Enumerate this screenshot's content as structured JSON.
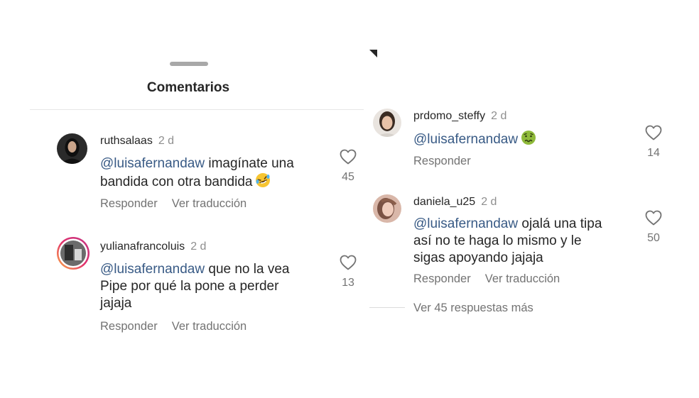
{
  "sheet": {
    "title": "Comentarios"
  },
  "left_comments": [
    {
      "username": "ruthsalaas",
      "time": "2 d",
      "mention": "@luisafernandaw",
      "lines": [
        "imagínate una",
        "bandida con otra bandida"
      ],
      "likes": "45",
      "reply": "Responder",
      "translate": "Ver traducción"
    },
    {
      "username": "yulianafrancoluis",
      "time": "2 d",
      "mention": "@luisafernandaw",
      "lines": [
        "que no la vea",
        "Pipe por qué la pone a perder",
        "jajaja"
      ],
      "likes": "13",
      "reply": "Responder",
      "translate": "Ver traducción"
    }
  ],
  "right_comments": [
    {
      "username": "prdomo_steffy",
      "time": "2 d",
      "mention": "@luisafernandaw",
      "lines": [
        ""
      ],
      "likes": "14",
      "reply": "Responder"
    },
    {
      "username": "daniela_u25",
      "time": "2 d",
      "mention": "@luisafernandaw",
      "lines": [
        "ojalá una tipa",
        "así no te haga lo mismo y le",
        "sigas apoyando jajaja"
      ],
      "likes": "50",
      "reply": "Responder",
      "translate": "Ver traducción"
    }
  ],
  "view_more": "Ver 45 respuestas más",
  "icons": {
    "like": "heart-outline-icon",
    "emoji_1": "rolling-laughing-emoji-icon",
    "emoji_2": "nauseated-face-emoji-icon"
  },
  "colors": {
    "mention": "#385a85",
    "muted": "#737373",
    "text": "#262626"
  }
}
